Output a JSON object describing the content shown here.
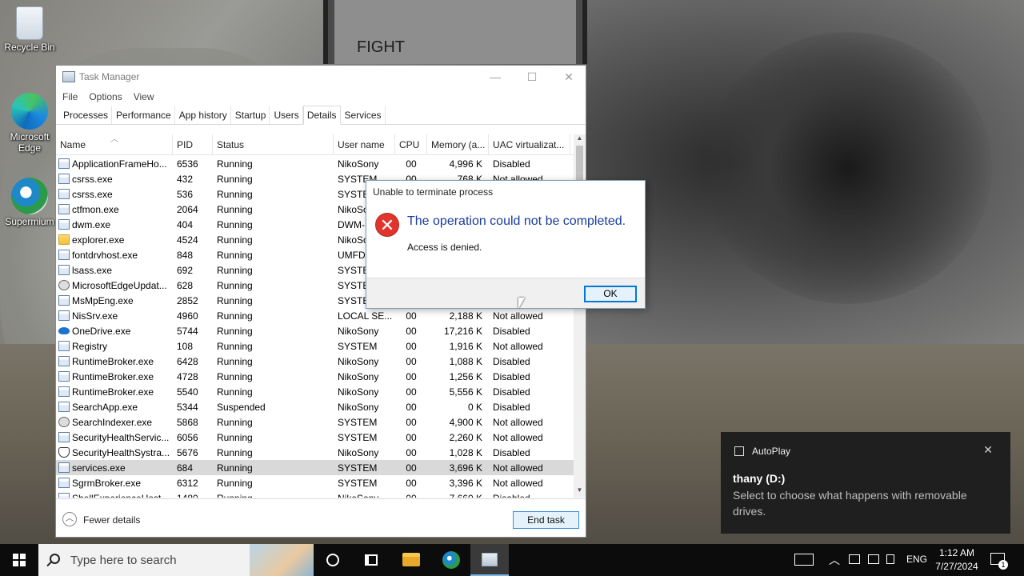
{
  "desktop": {
    "poster_text": "FIGHT",
    "icons": [
      {
        "label": "Recycle Bin"
      },
      {
        "label": "Microsoft Edge"
      },
      {
        "label": "Supermium"
      }
    ]
  },
  "task_manager": {
    "title": "Task Manager",
    "menu": [
      "File",
      "Options",
      "View"
    ],
    "tabs": [
      "Processes",
      "Performance",
      "App history",
      "Startup",
      "Users",
      "Details",
      "Services"
    ],
    "active_tab": "Details",
    "columns": [
      "Name",
      "PID",
      "Status",
      "User name",
      "CPU",
      "Memory (a...",
      "UAC virtualizat..."
    ],
    "rows": [
      {
        "name": "ApplicationFrameHo...",
        "pid": "6536",
        "status": "Running",
        "user": "NikoSony",
        "cpu": "00",
        "mem": "4,996 K",
        "uac": "Disabled"
      },
      {
        "name": "csrss.exe",
        "pid": "432",
        "status": "Running",
        "user": "SYSTEM",
        "cpu": "00",
        "mem": "768 K",
        "uac": "Not allowed"
      },
      {
        "name": "csrss.exe",
        "pid": "536",
        "status": "Running",
        "user": "SYSTEM",
        "cpu": "",
        "mem": "",
        "uac": ""
      },
      {
        "name": "ctfmon.exe",
        "pid": "2064",
        "status": "Running",
        "user": "NikoSo",
        "cpu": "",
        "mem": "",
        "uac": ""
      },
      {
        "name": "dwm.exe",
        "pid": "404",
        "status": "Running",
        "user": "DWM-",
        "cpu": "",
        "mem": "",
        "uac": ""
      },
      {
        "name": "explorer.exe",
        "pid": "4524",
        "status": "Running",
        "user": "NikoSo",
        "cpu": "",
        "mem": "",
        "uac": ""
      },
      {
        "name": "fontdrvhost.exe",
        "pid": "848",
        "status": "Running",
        "user": "UMFD",
        "cpu": "",
        "mem": "",
        "uac": ""
      },
      {
        "name": "lsass.exe",
        "pid": "692",
        "status": "Running",
        "user": "SYSTEM",
        "cpu": "",
        "mem": "",
        "uac": ""
      },
      {
        "name": "MicrosoftEdgeUpdat...",
        "pid": "628",
        "status": "Running",
        "user": "SYSTEM",
        "cpu": "",
        "mem": "",
        "uac": ""
      },
      {
        "name": "MsMpEng.exe",
        "pid": "2852",
        "status": "Running",
        "user": "SYSTEM",
        "cpu": "",
        "mem": "",
        "uac": ""
      },
      {
        "name": "NisSrv.exe",
        "pid": "4960",
        "status": "Running",
        "user": "LOCAL SE...",
        "cpu": "00",
        "mem": "2,188 K",
        "uac": "Not allowed"
      },
      {
        "name": "OneDrive.exe",
        "pid": "5744",
        "status": "Running",
        "user": "NikoSony",
        "cpu": "00",
        "mem": "17,216 K",
        "uac": "Disabled"
      },
      {
        "name": "Registry",
        "pid": "108",
        "status": "Running",
        "user": "SYSTEM",
        "cpu": "00",
        "mem": "1,916 K",
        "uac": "Not allowed"
      },
      {
        "name": "RuntimeBroker.exe",
        "pid": "6428",
        "status": "Running",
        "user": "NikoSony",
        "cpu": "00",
        "mem": "1,088 K",
        "uac": "Disabled"
      },
      {
        "name": "RuntimeBroker.exe",
        "pid": "4728",
        "status": "Running",
        "user": "NikoSony",
        "cpu": "00",
        "mem": "1,256 K",
        "uac": "Disabled"
      },
      {
        "name": "RuntimeBroker.exe",
        "pid": "5540",
        "status": "Running",
        "user": "NikoSony",
        "cpu": "00",
        "mem": "5,556 K",
        "uac": "Disabled"
      },
      {
        "name": "SearchApp.exe",
        "pid": "5344",
        "status": "Suspended",
        "user": "NikoSony",
        "cpu": "00",
        "mem": "0 K",
        "uac": "Disabled"
      },
      {
        "name": "SearchIndexer.exe",
        "pid": "5868",
        "status": "Running",
        "user": "SYSTEM",
        "cpu": "00",
        "mem": "4,900 K",
        "uac": "Not allowed"
      },
      {
        "name": "SecurityHealthServic...",
        "pid": "6056",
        "status": "Running",
        "user": "SYSTEM",
        "cpu": "00",
        "mem": "2,260 K",
        "uac": "Not allowed"
      },
      {
        "name": "SecurityHealthSystra...",
        "pid": "5676",
        "status": "Running",
        "user": "NikoSony",
        "cpu": "00",
        "mem": "1,028 K",
        "uac": "Disabled"
      },
      {
        "name": "services.exe",
        "pid": "684",
        "status": "Running",
        "user": "SYSTEM",
        "cpu": "00",
        "mem": "3,696 K",
        "uac": "Not allowed"
      },
      {
        "name": "SgrmBroker.exe",
        "pid": "6312",
        "status": "Running",
        "user": "SYSTEM",
        "cpu": "00",
        "mem": "3,396 K",
        "uac": "Not allowed"
      },
      {
        "name": "ShellExperienceHost...",
        "pid": "1480",
        "status": "Running",
        "user": "NikoSony",
        "cpu": "00",
        "mem": "7,660 K",
        "uac": "Disabled"
      }
    ],
    "selected_row": "services.exe",
    "fewer_details": "Fewer details",
    "end_task": "End task"
  },
  "dialog": {
    "title": "Unable to terminate process",
    "main": "The operation could not be completed.",
    "sub": "Access is denied.",
    "ok": "OK"
  },
  "toast": {
    "app": "AutoPlay",
    "title": "thany (D:)",
    "body": "Select to choose what happens with removable drives."
  },
  "taskbar": {
    "search_placeholder": "Type here to search",
    "lang": "ENG",
    "time": "1:12 AM",
    "date": "7/27/2024",
    "notification_count": "1"
  },
  "colors": {
    "accent": "#0078d7",
    "error": "#e0342c",
    "dialog_heading": "#1a3d9c"
  }
}
